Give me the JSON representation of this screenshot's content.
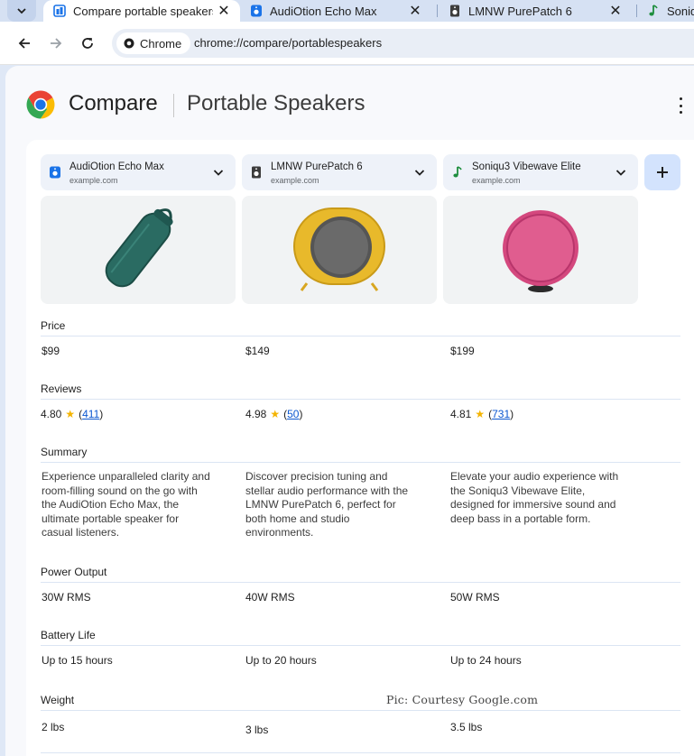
{
  "tabs": [
    {
      "title": "Compare portable speakers",
      "active": true,
      "favicon": "compare-icon"
    },
    {
      "title": "AudiOtion Echo Max",
      "active": false,
      "favicon": "speaker-icon"
    },
    {
      "title": "LMNW PurePatch 6",
      "active": false,
      "favicon": "speaker-icon"
    },
    {
      "title": "Soniq",
      "active": false,
      "favicon": "music-note-icon"
    }
  ],
  "toolbar": {
    "chip_label": "Chrome",
    "url_scheme": "chrome://",
    "url_path": "compare/portablespeakers"
  },
  "header": {
    "title": "Compare",
    "topic": "Portable Speakers"
  },
  "products": [
    {
      "name": "AudiOtion Echo Max",
      "domain": "example.com",
      "favicon": "speaker-icon",
      "color": "#2f6f66",
      "price": "$99",
      "rating": "4.80",
      "review_count": "411",
      "summary": "Experience unparalleled clarity and room-filling sound on the go with the AudiOtion Echo Max, the ultimate portable speaker for casual listeners.",
      "power": "30W RMS",
      "battery": "Up to 15 hours",
      "weight": "2 lbs"
    },
    {
      "name": "LMNW PurePatch 6",
      "domain": "example.com",
      "favicon": "speaker-icon",
      "color": "#e8b92b",
      "price": "$149",
      "rating": "4.98",
      "review_count": "50",
      "summary": "Discover precision tuning and stellar audio performance with the LMNW PurePatch 6, perfect for both home and studio environments.",
      "power": "40W RMS",
      "battery": "Up to 20 hours",
      "weight": "3 lbs"
    },
    {
      "name": "Soniqu3 Vibewave Elite",
      "domain": "example.com",
      "favicon": "music-note-icon",
      "color": "#d4487e",
      "price": "$199",
      "rating": "4.81",
      "review_count": "731",
      "summary": "Elevate your audio experience with the Soniqu3 Vibewave Elite, designed for immersive sound and deep bass in a portable form.",
      "power": "50W RMS",
      "battery": "Up to 24 hours",
      "weight": "3.5 lbs"
    }
  ],
  "rows": {
    "price": "Price",
    "reviews": "Reviews",
    "summary": "Summary",
    "power": "Power Output",
    "battery": "Battery Life",
    "weight": "Weight"
  },
  "watermark": "Pic: Courtesy Google.com",
  "colors": {
    "accent": "#0b57d0",
    "star": "#f4b400",
    "add_button_bg": "#d3e3fd"
  }
}
